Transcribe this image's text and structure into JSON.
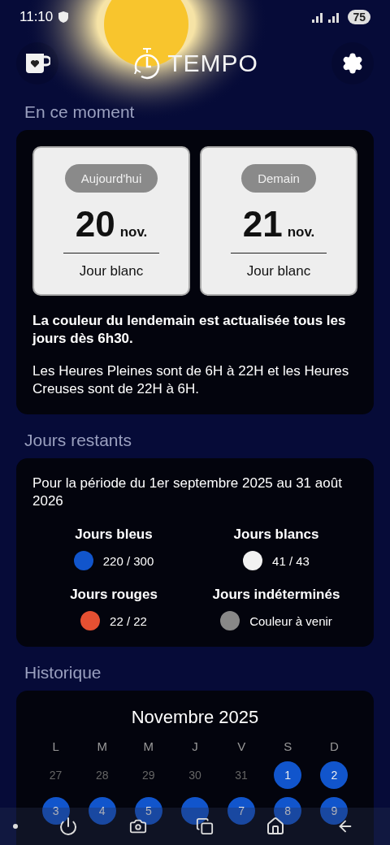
{
  "status_bar": {
    "time": "11:10",
    "battery": "75"
  },
  "header": {
    "title": "TEMPO"
  },
  "now": {
    "heading": "En ce moment",
    "days": [
      {
        "badge": "Aujourd'hui",
        "day": "20",
        "month": "nov.",
        "label": "Jour blanc",
        "color": "#eeeeee"
      },
      {
        "badge": "Demain",
        "day": "21",
        "month": "nov.",
        "label": "Jour blanc",
        "color": "#eeeeee"
      }
    ],
    "note_bold": "La couleur du lendemain est actualisée tous les jours dès 6h30.",
    "note": "Les Heures Pleines sont de 6H à 22H et les Heures Creuses sont de 22H à 6H."
  },
  "remaining": {
    "heading": "Jours restants",
    "period": "Pour la période du 1er septembre 2025 au 31 août 2026",
    "items": [
      {
        "title": "Jours bleus",
        "value": "220 / 300",
        "color": "#1155cc"
      },
      {
        "title": "Jours blancs",
        "value": "41 / 43",
        "color": "#f2f2f2"
      },
      {
        "title": "Jours rouges",
        "value": "22 / 22",
        "color": "#e55032"
      },
      {
        "title": "Jours indéterminés",
        "value": "Couleur à venir",
        "color": "#888888"
      }
    ]
  },
  "history": {
    "heading": "Historique",
    "month": "Novembre 2025",
    "weekdays": [
      "L",
      "M",
      "M",
      "J",
      "V",
      "S",
      "D"
    ],
    "weeks": [
      [
        {
          "label": "27",
          "outside": true
        },
        {
          "label": "28",
          "outside": true
        },
        {
          "label": "29",
          "outside": true
        },
        {
          "label": "30",
          "outside": true
        },
        {
          "label": "31",
          "outside": true
        },
        {
          "label": "1",
          "color": "#1155cc"
        },
        {
          "label": "2",
          "color": "#1155cc"
        }
      ],
      [
        {
          "label": "3",
          "color": "#1155cc"
        },
        {
          "label": "4",
          "color": "#1155cc"
        },
        {
          "label": "5",
          "color": "#1155cc"
        },
        {
          "color": "#1155cc"
        },
        {
          "label": "7",
          "color": "#1155cc"
        },
        {
          "label": "8",
          "color": "#1155cc"
        },
        {
          "label": "9",
          "color": "#1155cc"
        }
      ]
    ]
  }
}
